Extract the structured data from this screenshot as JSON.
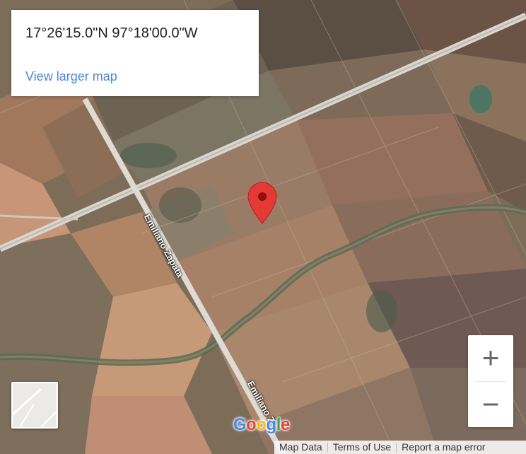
{
  "info_card": {
    "coordinates": "17°26'15.0\"N 97°18'00.0\"W",
    "link_label": "View larger map"
  },
  "roads": [
    {
      "label": "Emiliano Zapata"
    },
    {
      "label": "Emiliano Z"
    }
  ],
  "map": {
    "marker": "red-location-pin",
    "imagery": "satellite"
  },
  "controls": {
    "zoom_in": "+",
    "zoom_out": "−",
    "layer_toggle_icon": "map-layer-icon"
  },
  "logo_letters": [
    "G",
    "o",
    "o",
    "g",
    "l",
    "e"
  ],
  "footer": {
    "map_data": "Map Data",
    "terms": "Terms of Use",
    "report": "Report a map error"
  },
  "colors": {
    "link": "#4a86d8",
    "pin": "#e53935",
    "logo": [
      "#4285F4",
      "#EA4335",
      "#FBBC05",
      "#4285F4",
      "#34A853",
      "#EA4335"
    ]
  }
}
